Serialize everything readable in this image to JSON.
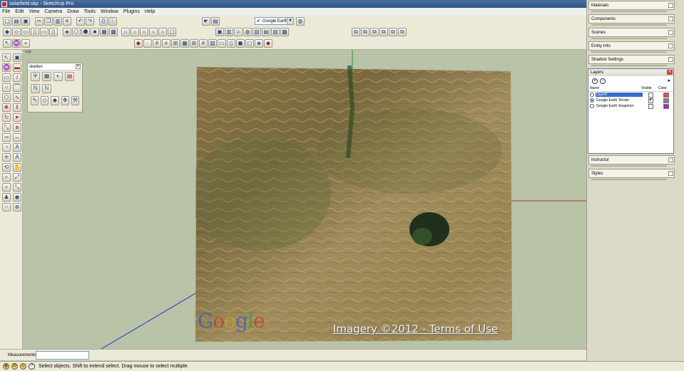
{
  "window": {
    "title": "solarfield.skp - SketchUp Pro",
    "buttons": [
      "_",
      "□",
      "✕"
    ]
  },
  "menu": [
    "File",
    "Edit",
    "View",
    "Camera",
    "Draw",
    "Tools",
    "Window",
    "Plugins",
    "Help"
  ],
  "toolbar": {
    "google_earth_select": "Google Earth"
  },
  "viewport": {
    "view_name": "Top",
    "imagery_prefix": "Imagery ©2012 - ",
    "imagery_link": "Terms of Use",
    "watermark": "Google"
  },
  "skelion": {
    "title": "skelion"
  },
  "trays": [
    {
      "label": "Materials"
    },
    {
      "label": "Components"
    },
    {
      "label": "Scenes"
    },
    {
      "label": "Entity Info"
    },
    {
      "label": "Shadow Settings"
    },
    {
      "label": "Instructor"
    },
    {
      "label": "Styles"
    }
  ],
  "layers": {
    "title": "Layers",
    "columns": {
      "name": "Name",
      "visible": "Visible",
      "color": "Color"
    },
    "rows": [
      {
        "name": "Layer0",
        "active": false,
        "visible": false,
        "color": "#e05050",
        "selected": true
      },
      {
        "name": "Google Earth Terrain",
        "active": true,
        "visible": true,
        "color": "#808080",
        "selected": false
      },
      {
        "name": "Google Earth Snapshot",
        "active": false,
        "visible": false,
        "color": "#b020c0",
        "selected": false
      }
    ]
  },
  "measurements": {
    "label": "Measurements",
    "value": ""
  },
  "status": {
    "message": "Select objects. Shift to extend select. Drag mouse to select multiple."
  }
}
